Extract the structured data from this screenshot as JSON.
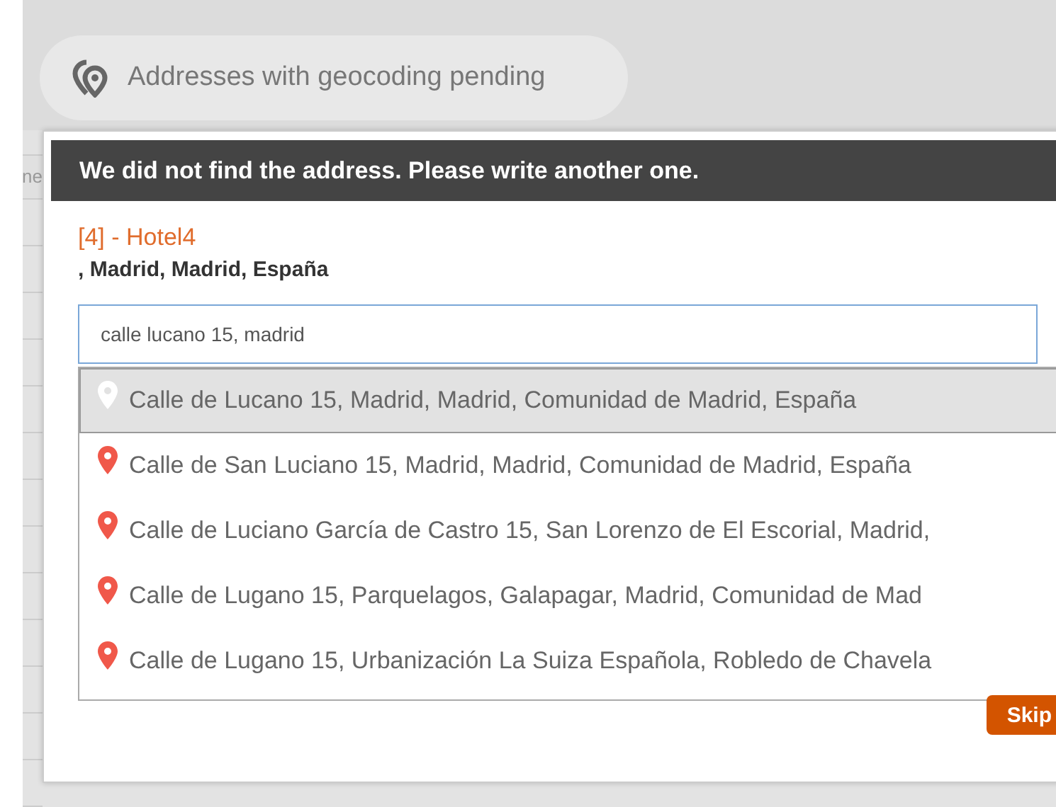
{
  "header": {
    "title": "Addresses with geocoding pending"
  },
  "background_table": {
    "column_1": "ne"
  },
  "dialog": {
    "title": "We did not find the address. Please write another one.",
    "record_name": "[4] - Hotel4",
    "record_address": ", Madrid, Madrid, España",
    "search": {
      "value": "calle lucano 15, madrid"
    },
    "suggestions": [
      {
        "text": "Calle de Lucano 15, Madrid, Madrid, Comunidad de Madrid, España",
        "selected": true
      },
      {
        "text": "Calle de San Luciano 15, Madrid, Madrid, Comunidad de Madrid, España",
        "selected": false
      },
      {
        "text": "Calle de Luciano García de Castro 15, San Lorenzo de El Escorial, Madrid,",
        "selected": false
      },
      {
        "text": "Calle de Lugano 15, Parquelagos, Galapagar, Madrid, Comunidad de Mad",
        "selected": false
      },
      {
        "text": "Calle de Lugano 15, Urbanización La Suiza Española, Robledo de Chavela",
        "selected": false
      }
    ],
    "buttons": [
      "Skip"
    ]
  }
}
